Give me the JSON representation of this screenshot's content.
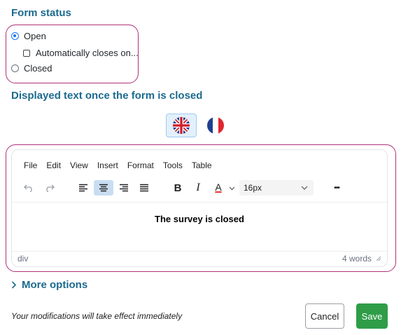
{
  "form_status": {
    "title": "Form status",
    "options": [
      {
        "label": "Open",
        "selected": true
      },
      {
        "label": "Closed",
        "selected": false
      }
    ],
    "auto_close": {
      "label": "Automatically closes on...",
      "checked": false
    }
  },
  "closed_text": {
    "title": "Displayed text once the form is closed",
    "languages": [
      {
        "icon": "uk-flag-icon",
        "active": true
      },
      {
        "icon": "france-flag-icon",
        "active": false
      }
    ]
  },
  "editor": {
    "menu": [
      "File",
      "Edit",
      "View",
      "Insert",
      "Format",
      "Tools",
      "Table"
    ],
    "toolbar_icons": [
      "undo-icon",
      "redo-icon",
      "align-left-icon",
      "align-center-icon",
      "align-right-icon",
      "align-justify-icon",
      "bold-icon",
      "italic-icon",
      "text-color-icon",
      "font-size-select",
      "more-icon"
    ],
    "active_alignment": "align-center",
    "bold_glyph": "B",
    "italic_glyph": "I",
    "color_glyph": "A",
    "text_color": "#e53935",
    "font_size": "16px",
    "more_glyph": "•••",
    "content": "The survey is closed",
    "status_path": "div",
    "word_count": "4 words"
  },
  "more_options": {
    "label": "More options"
  },
  "footer": {
    "note": "Your modifications will take effect immediately",
    "cancel_label": "Cancel",
    "save_label": "Save"
  },
  "colors": {
    "accent": "#1c6a8e",
    "highlight": "#b0307a",
    "save": "#2f9d48",
    "radio": "#1a73e8"
  }
}
